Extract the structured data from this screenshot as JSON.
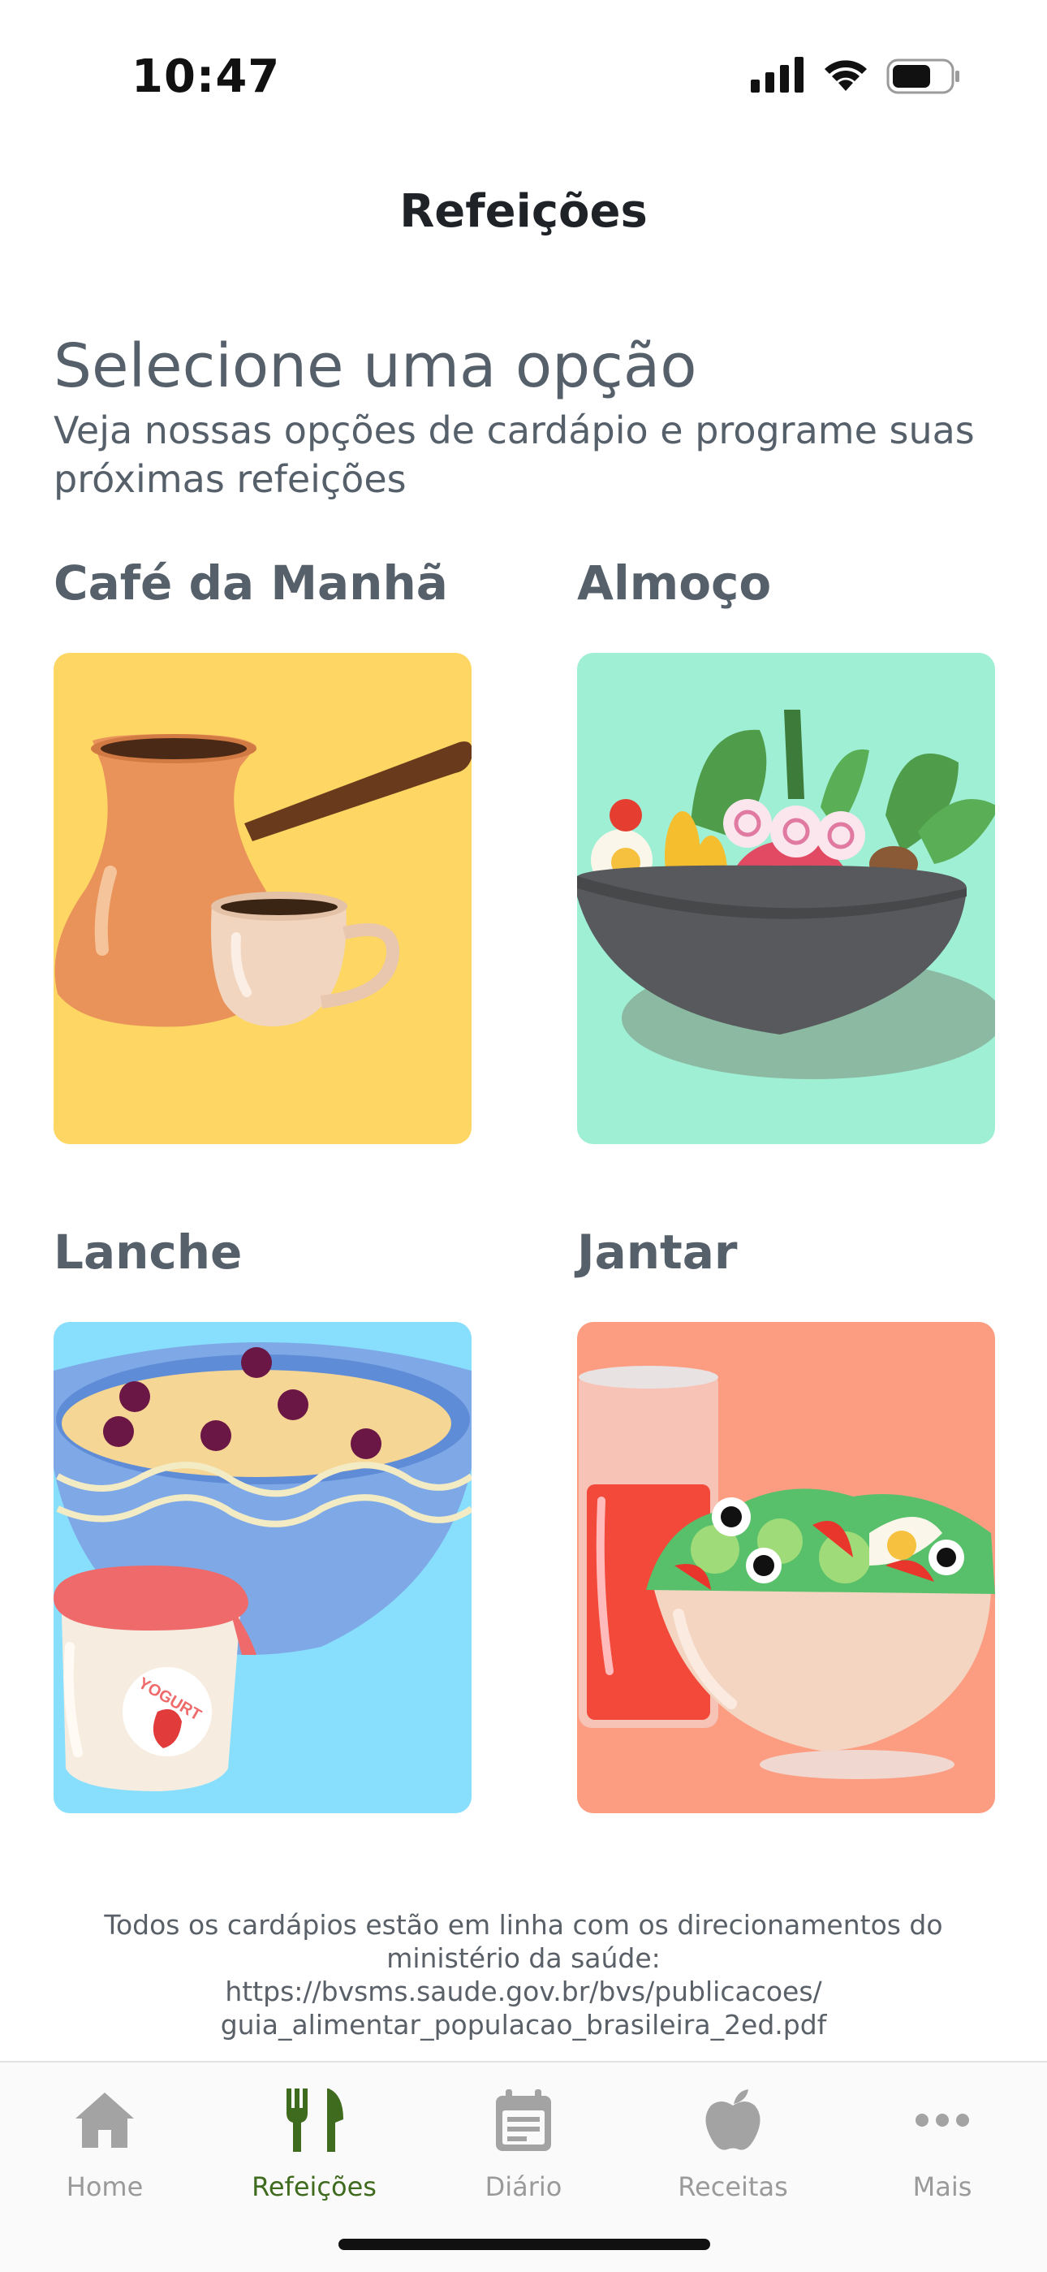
{
  "status_bar": {
    "time": "10:47",
    "icons": [
      "signal-icon",
      "wifi-icon",
      "battery-icon"
    ]
  },
  "header": {
    "title": "Refeições"
  },
  "intro": {
    "heading": "Selecione uma opção",
    "subheading": "Veja nossas opções de cardápio e programe suas próximas refeições"
  },
  "meals": [
    {
      "label": "Café da Manhã",
      "color": "#fdd663"
    },
    {
      "label": "Almoço",
      "color": "#9fefd5"
    },
    {
      "label": "Lanche",
      "color": "#87dffd"
    },
    {
      "label": "Jantar",
      "color": "#fc9d82"
    }
  ],
  "footer_note": {
    "text": "Todos os cardápios estão em linha com os direcionamentos do ministério da saúde:",
    "link": "https://bvsms.saude.gov.br/bvs/publicacoes/ guia_alimentar_populacao_brasileira_2ed.pdf"
  },
  "tabs": [
    {
      "label": "Home",
      "icon": "home-icon",
      "active": false
    },
    {
      "label": "Refeições",
      "icon": "fork-knife-icon",
      "active": true
    },
    {
      "label": "Diário",
      "icon": "calendar-icon",
      "active": false
    },
    {
      "label": "Receitas",
      "icon": "apple-icon",
      "active": false
    },
    {
      "label": "Mais",
      "icon": "more-icon",
      "active": false
    }
  ],
  "colors": {
    "accent": "#3f6b1e",
    "text": "#56606a",
    "tab_inactive": "#9a9a9a"
  }
}
